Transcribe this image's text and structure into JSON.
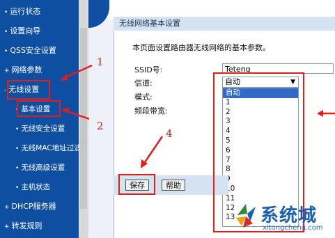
{
  "sidebar": {
    "items": [
      {
        "label": "运行状态"
      },
      {
        "label": "设置向导"
      },
      {
        "label": "QSS安全设置"
      },
      {
        "label": "网络参数"
      },
      {
        "label": "无线设置"
      },
      {
        "label": "基本设置"
      },
      {
        "label": "无线安全设置"
      },
      {
        "label": "无线MAC地址过滤"
      },
      {
        "label": "无线高级设置"
      },
      {
        "label": "主机状态"
      },
      {
        "label": "DHCP服务器"
      },
      {
        "label": "转发规则"
      }
    ]
  },
  "panel": {
    "title": "无线网络基本设置",
    "description": "本页面设置路由器无线网络的基本参数。"
  },
  "form": {
    "ssid_label": "SSID号:",
    "ssid_value": "Teteng",
    "channel_label": "信道:",
    "channel_value": "自动",
    "mode_label": "模式:",
    "bandwidth_label": "频段带宽:"
  },
  "channel_options": [
    "自动",
    "1",
    "2",
    "3",
    "4",
    "5",
    "6",
    "7",
    "8",
    "9",
    "10",
    "11",
    "12",
    "13"
  ],
  "buttons": {
    "save": "保存",
    "help": "帮助"
  },
  "annotations": {
    "n1": "1",
    "n2": "2",
    "n4": "4"
  },
  "watermark": {
    "text": "系统城",
    "url": "xitongcheng.com"
  },
  "colors": {
    "sidebar": "#0e4fa1",
    "highlight": "#e01e1e",
    "selected_option": "#3169c6"
  }
}
